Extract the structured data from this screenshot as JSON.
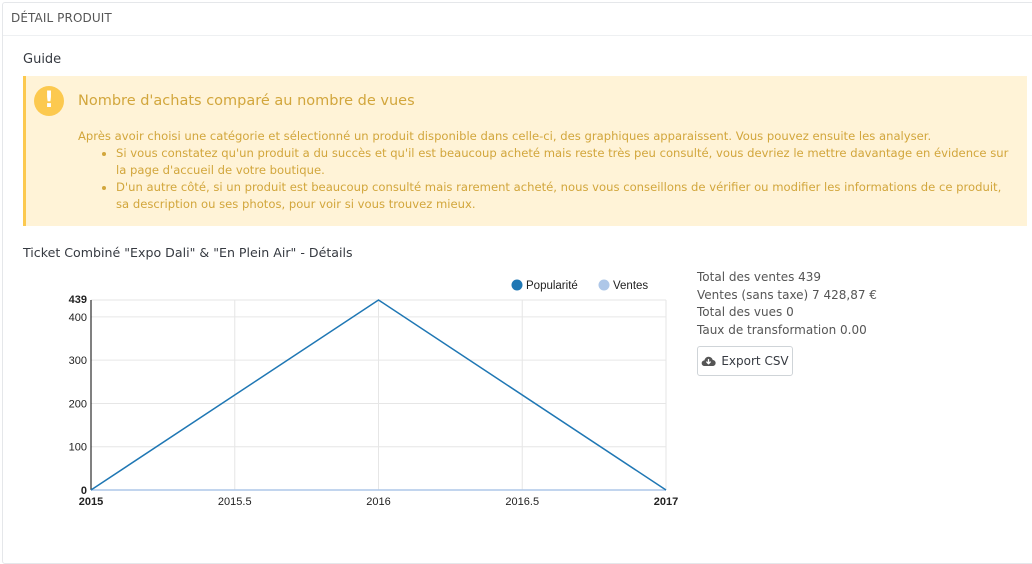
{
  "panel": {
    "heading": "DÉTAIL PRODUIT"
  },
  "guide": {
    "title": "Guide",
    "alert_title": "Nombre d'achats comparé au nombre de vues",
    "intro": "Après avoir choisi une catégorie et sélectionné un produit disponible dans celle-ci, des graphiques apparaissent. Vous pouvez ensuite les analyser.",
    "bullets": [
      "Si vous constatez qu'un produit a du succès et qu'il est beaucoup acheté mais reste très peu consulté, vous devriez le mettre davantage en évidence sur la page d'accueil de votre boutique.",
      "D'un autre côté, si un produit est beaucoup consulté mais rarement acheté, nous vous conseillons de vérifier ou modifier les informations de ce produit, sa description ou ses photos, pour voir si vous trouvez mieux."
    ],
    "icon": "exclamation-icon",
    "colors": {
      "alert_bg": "#fff3d7",
      "alert_text": "#d2a63c",
      "alert_icon": "#fcc94f"
    }
  },
  "product": {
    "title": "Ticket Combiné \"Expo Dali\" & \"En Plein Air\" - Détails"
  },
  "stats": {
    "total_sales": "Total des ventes 439",
    "sales_excl_tax": "Ventes (sans taxe) 7 428,87 €",
    "total_views": "Total des vues 0",
    "conversion_rate": "Taux de transformation 0.00"
  },
  "export": {
    "label": "Export CSV",
    "icon": "cloud-download-icon"
  },
  "chart_data": {
    "type": "line",
    "x_ticks": [
      "2015",
      "2015.5",
      "2016",
      "2016.5",
      "2017"
    ],
    "y_ticks": [
      "0",
      "100",
      "200",
      "300",
      "400",
      "439"
    ],
    "xlim": [
      2015,
      2017
    ],
    "ylim": [
      0,
      439
    ],
    "grid": true,
    "legend_position": "top-right",
    "series": [
      {
        "name": "Popularité",
        "color": "#1f77b4",
        "x": [
          2015,
          2016,
          2017
        ],
        "y": [
          0,
          439,
          0
        ]
      },
      {
        "name": "Ventes",
        "color": "#aec7e8",
        "x": [
          2015,
          2016,
          2017
        ],
        "y": [
          0,
          0,
          0
        ]
      }
    ]
  }
}
